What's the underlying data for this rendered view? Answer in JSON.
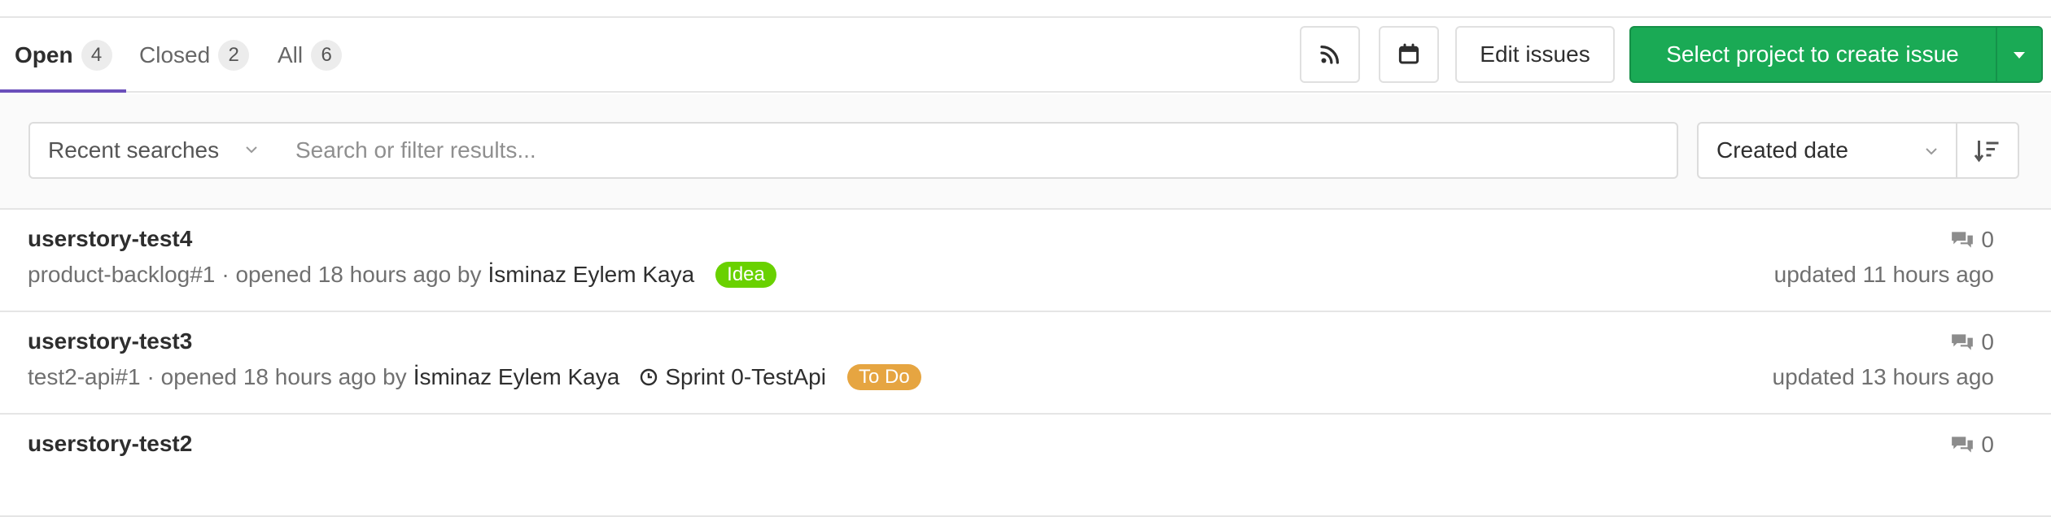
{
  "tabs": [
    {
      "label": "Open",
      "count": "4"
    },
    {
      "label": "Closed",
      "count": "2"
    },
    {
      "label": "All",
      "count": "6"
    }
  ],
  "toolbar": {
    "rss_icon": "rss-icon",
    "calendar_icon": "calendar-icon",
    "edit_issues_label": "Edit issues",
    "create_issue_label": "Select project to create issue",
    "dropdown_icon": "caret-down-icon"
  },
  "filter": {
    "recent_searches_label": "Recent searches",
    "search_placeholder": "Search or filter results...",
    "sort_label": "Created date",
    "sort_direction_icon": "sort-descending-icon"
  },
  "issues": [
    {
      "title": "userstory-test4",
      "reference": "product-backlog#1",
      "opened_text": "· opened 18 hours ago by",
      "author": "İsminaz Eylem Kaya",
      "milestone": "",
      "label": "Idea",
      "label_color": "#69d100",
      "comments": "0",
      "updated": "updated 11 hours ago"
    },
    {
      "title": "userstory-test3",
      "reference": "test2-api#1",
      "opened_text": "· opened 18 hours ago by",
      "author": "İsminaz Eylem Kaya",
      "milestone": "Sprint 0-TestApi",
      "label": "To Do",
      "label_color": "#e6a541",
      "comments": "0",
      "updated": "updated 13 hours ago"
    },
    {
      "title": "userstory-test2",
      "comments": "0"
    }
  ],
  "colors": {
    "primary_green": "#1aaa55",
    "active_tab_underline": "#6b4fbb"
  }
}
